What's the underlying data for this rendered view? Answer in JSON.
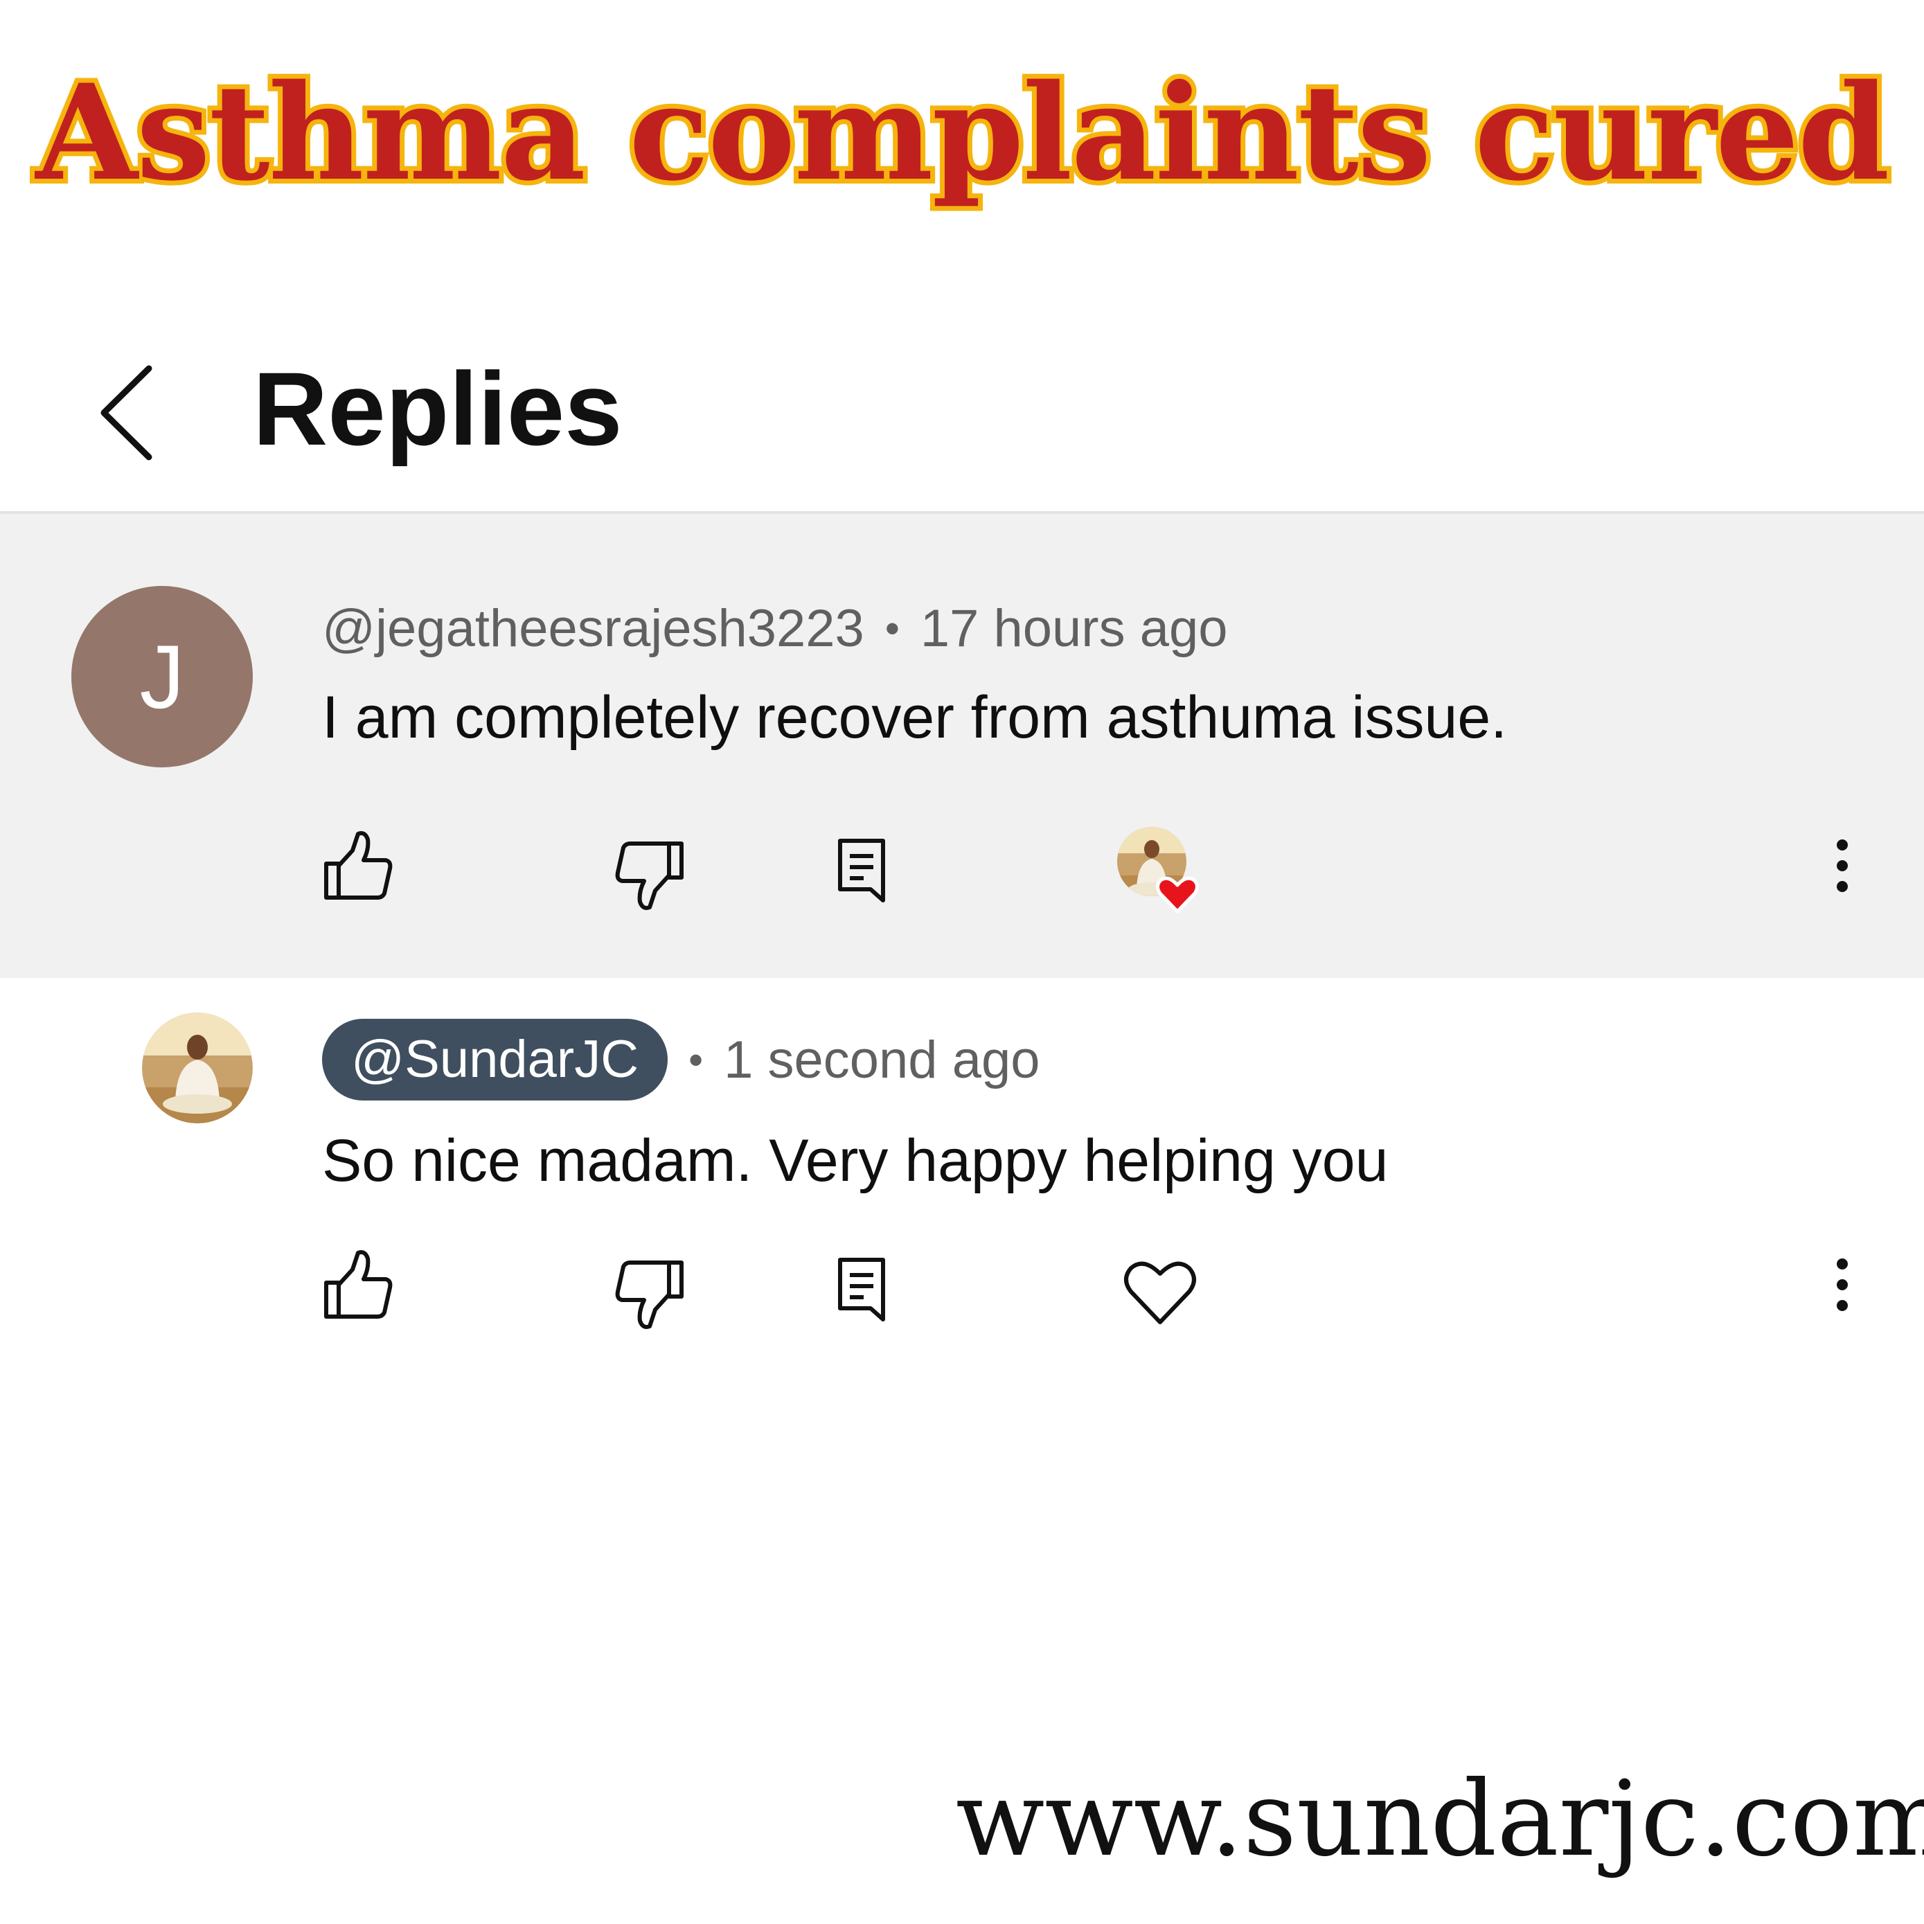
{
  "banner": {
    "title": "Asthma complaints cured"
  },
  "header": {
    "back_icon": "chevron-left-icon",
    "title": "Replies"
  },
  "comments": [
    {
      "avatar_letter": "J",
      "author": "@jegatheesrajesh3223",
      "separator": "•",
      "time": "17 hours ago",
      "text": "I am completely recover from asthuma issue.",
      "hearted_by_creator": true,
      "icons": [
        "thumbs-up-icon",
        "thumbs-down-icon",
        "reply-icon",
        "creator-heart-icon",
        "more-vert-icon"
      ]
    },
    {
      "author": "@SundarJC",
      "author_is_creator": true,
      "separator": "•",
      "time": "1 second ago",
      "text": "So nice madam. Very happy helping you",
      "hearted_by_creator": false,
      "icons": [
        "thumbs-up-icon",
        "thumbs-down-icon",
        "reply-icon",
        "heart-outline-icon",
        "more-vert-icon"
      ]
    }
  ],
  "footer": {
    "website": "www.sundarjc.com"
  },
  "colors": {
    "banner_fill": "#c0211f",
    "banner_stroke": "#f6b40e",
    "avatar_bg": "#94776a",
    "creator_chip_bg": "#3f4f5f",
    "heart_red": "#e8141c",
    "highlight_bg": "#f1f1f1"
  }
}
